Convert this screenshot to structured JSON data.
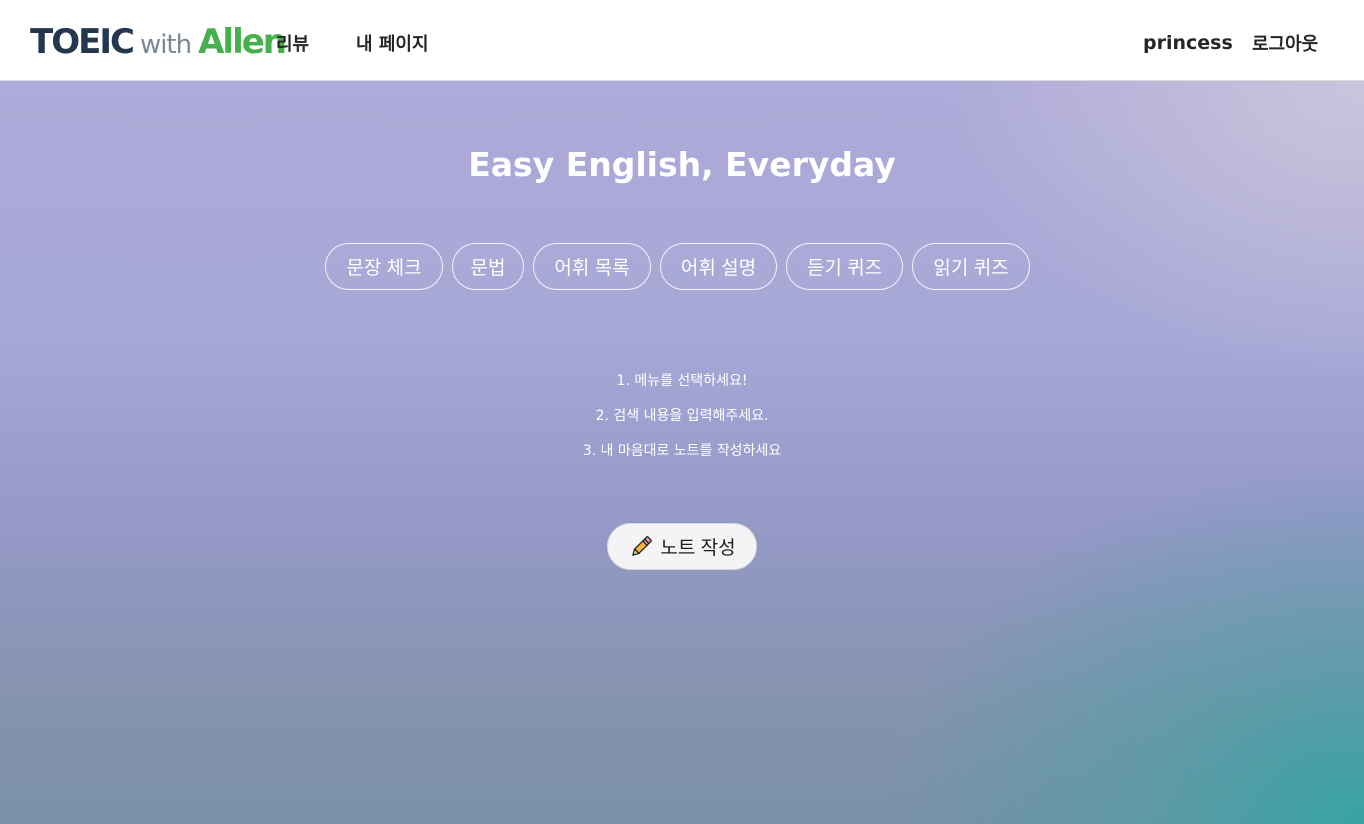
{
  "header": {
    "logo": {
      "part1": "TOEIC",
      "part2": "with",
      "part3": "Allen"
    },
    "nav": {
      "review": "리뷰",
      "mypage": "내 페이지"
    },
    "username": "princess",
    "logout": "로그아웃"
  },
  "hero": {
    "title": "Easy English, Everyday",
    "menu": [
      {
        "label": "문장 체크"
      },
      {
        "label": "문법"
      },
      {
        "label": "어휘 목록"
      },
      {
        "label": "어휘 설명"
      },
      {
        "label": "듣기 퀴즈"
      },
      {
        "label": "읽기 퀴즈"
      }
    ],
    "steps": [
      "1. 메뉴를 선택하세요!",
      "2. 검색 내용을 입력해주세요.",
      "3. 내 마음대로 노트를 작성하세요"
    ],
    "write_button": {
      "icon": "pencil-icon",
      "label": "노트 작성"
    }
  },
  "colors": {
    "logo_dark": "#23374e",
    "logo_green": "#45b04c",
    "hero_top": "#aeaad9",
    "hero_bottom_right": "#34a4a4"
  }
}
